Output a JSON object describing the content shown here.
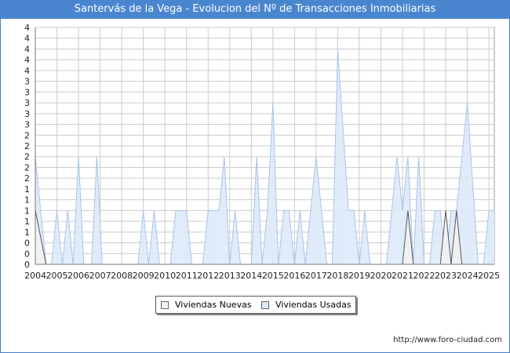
{
  "title": "Santervás de la Vega - Evolucion del Nº de Transacciones Inmobiliarias",
  "footer": "http://www.foro-ciudad.com",
  "colors": {
    "title_bg": "#4a86d0",
    "nuevas_fill": "#f2f2f2",
    "nuevas_line": "#555555",
    "usadas_fill": "#ddeaf8",
    "usadas_line": "#a9c4ea",
    "grid": "#cccccc"
  },
  "chart_data": {
    "type": "area",
    "title": "Santervás de la Vega - Evolucion del Nº de Transacciones Inmobiliarias",
    "xlabel": "",
    "ylabel": "",
    "ylim": [
      0,
      4.4
    ],
    "x_range": [
      2004,
      2025.25
    ],
    "grid": true,
    "legend_position": "bottom-center",
    "y_tick_values": [
      0,
      0.2,
      0.4,
      0.6,
      0.8,
      1.0,
      1.2,
      1.4,
      1.6,
      1.8,
      2.0,
      2.2,
      2.4,
      2.6,
      2.8,
      3.0,
      3.2,
      3.4,
      3.6,
      3.8,
      4.0,
      4.2,
      4.4
    ],
    "y_tick_labels": [
      "0",
      "0",
      "0",
      "1",
      "1",
      "1",
      "1",
      "1",
      "2",
      "2",
      "2",
      "2",
      "2",
      "3",
      "3",
      "3",
      "3",
      "3",
      "4",
      "4",
      "4",
      "4",
      "4"
    ],
    "x_ticks": [
      "2004",
      "2005",
      "2006",
      "2007",
      "2008",
      "2009",
      "2010",
      "2011",
      "2012",
      "2013",
      "2014",
      "2015",
      "2016",
      "2017",
      "2018",
      "2019",
      "2020",
      "2021",
      "2022",
      "2023",
      "2024",
      "2025"
    ],
    "series": [
      {
        "name": "Viviendas Nuevas",
        "points": [
          [
            2004.0,
            1
          ],
          [
            2004.5,
            0
          ],
          [
            2021.0,
            0
          ],
          [
            2021.25,
            1
          ],
          [
            2021.5,
            0
          ],
          [
            2022.75,
            0
          ],
          [
            2023.0,
            1
          ],
          [
            2023.25,
            0
          ],
          [
            2023.5,
            1
          ],
          [
            2023.75,
            0
          ]
        ]
      },
      {
        "name": "Viviendas Usadas",
        "points": [
          [
            2004.0,
            2
          ],
          [
            2004.5,
            0
          ],
          [
            2004.75,
            0
          ],
          [
            2005.0,
            1
          ],
          [
            2005.25,
            0
          ],
          [
            2005.5,
            1
          ],
          [
            2005.75,
            0
          ],
          [
            2006.0,
            2
          ],
          [
            2006.25,
            0
          ],
          [
            2006.5,
            0
          ],
          [
            2006.75,
            0
          ],
          [
            2007.0,
            0
          ],
          [
            2007.25,
            0
          ],
          [
            2006.6,
            0
          ],
          [
            2007.4,
            0
          ],
          [
            2007.6,
            2
          ],
          [
            2007.85,
            0
          ]
        ]
      }
    ],
    "usadas_segments": [
      [
        [
          2004.0,
          2
        ],
        [
          2004.5,
          0
        ]
      ],
      [
        [
          2004.75,
          0
        ],
        [
          2005.0,
          1
        ],
        [
          2005.25,
          0
        ],
        [
          2005.5,
          1
        ],
        [
          2005.75,
          0
        ],
        [
          2006.0,
          2
        ],
        [
          2006.25,
          0
        ]
      ],
      [
        [
          2006.6,
          0
        ],
        [
          2006.85,
          2
        ],
        [
          2007.1,
          0
        ]
      ],
      [
        [
          2008.75,
          0
        ],
        [
          2009.0,
          1
        ],
        [
          2009.25,
          0
        ]
      ],
      [
        [
          2009.25,
          0
        ],
        [
          2009.5,
          1
        ],
        [
          2009.75,
          0
        ]
      ],
      [
        [
          2010.25,
          0
        ],
        [
          2010.5,
          1
        ],
        [
          2011.0,
          1
        ],
        [
          2011.25,
          0
        ]
      ],
      [
        [
          2011.75,
          0
        ],
        [
          2012.0,
          1
        ],
        [
          2012.5,
          1
        ],
        [
          2012.75,
          2
        ],
        [
          2013.0,
          0
        ]
      ],
      [
        [
          2013.0,
          0
        ],
        [
          2013.25,
          1
        ],
        [
          2013.5,
          0
        ]
      ],
      [
        [
          2014.0,
          0
        ],
        [
          2014.25,
          2
        ],
        [
          2014.5,
          0
        ]
      ],
      [
        [
          2014.5,
          0
        ],
        [
          2014.75,
          1
        ],
        [
          2015.0,
          3
        ],
        [
          2015.25,
          0
        ]
      ],
      [
        [
          2015.25,
          0
        ],
        [
          2015.5,
          1
        ],
        [
          2015.75,
          1
        ],
        [
          2016.0,
          0
        ]
      ],
      [
        [
          2016.0,
          0
        ],
        [
          2016.25,
          1
        ],
        [
          2016.5,
          0
        ]
      ],
      [
        [
          2016.5,
          0
        ],
        [
          2016.75,
          1
        ],
        [
          2017.0,
          2
        ],
        [
          2017.5,
          0
        ]
      ],
      [
        [
          2017.75,
          0
        ],
        [
          2018.0,
          4
        ],
        [
          2018.5,
          1
        ],
        [
          2018.75,
          1
        ],
        [
          2019.0,
          0
        ]
      ],
      [
        [
          2019.0,
          0
        ],
        [
          2019.25,
          1
        ],
        [
          2019.5,
          0
        ]
      ],
      [
        [
          2020.25,
          0
        ],
        [
          2020.5,
          1
        ],
        [
          2020.75,
          2
        ],
        [
          2021.0,
          1
        ],
        [
          2021.25,
          2
        ],
        [
          2021.5,
          0
        ]
      ],
      [
        [
          2021.5,
          0
        ],
        [
          2021.75,
          2
        ],
        [
          2022.0,
          0
        ]
      ],
      [
        [
          2022.25,
          0
        ],
        [
          2022.5,
          1
        ],
        [
          2022.75,
          1
        ],
        [
          2023.0,
          0
        ]
      ],
      [
        [
          2023.0,
          0
        ],
        [
          2023.25,
          1
        ],
        [
          2023.5,
          1
        ],
        [
          2023.75,
          2
        ],
        [
          2024.0,
          3
        ],
        [
          2024.5,
          0
        ]
      ],
      [
        [
          2024.75,
          0
        ],
        [
          2025.0,
          1
        ],
        [
          2025.25,
          1
        ]
      ]
    ],
    "nuevas_segments": [
      [
        [
          2004.0,
          1
        ],
        [
          2004.5,
          0
        ]
      ],
      [
        [
          2021.0,
          0
        ],
        [
          2021.25,
          1
        ],
        [
          2021.5,
          0
        ]
      ],
      [
        [
          2022.75,
          0
        ],
        [
          2023.0,
          1
        ],
        [
          2023.25,
          0
        ]
      ],
      [
        [
          2023.25,
          0
        ],
        [
          2023.5,
          1
        ],
        [
          2023.75,
          0
        ]
      ]
    ]
  },
  "legend": {
    "nuevas": "Viviendas Nuevas",
    "usadas": "Viviendas Usadas"
  }
}
